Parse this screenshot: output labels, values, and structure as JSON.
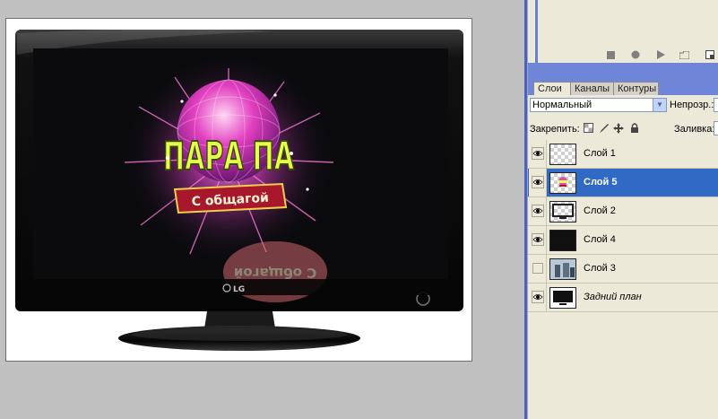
{
  "canvas": {
    "tv_brand": "LG",
    "logo_title": "ПАРА ПА",
    "logo_subtitle": "С общагой",
    "logo_subtitle_reflected": "С общагой"
  },
  "colors": {
    "workspace_bg": "#c0c0c0",
    "panel_bg": "#ece9d8",
    "panel_blue": "#6f86d8",
    "selection": "#316ac5",
    "logo_green": "#e5ff4a",
    "logo_pink": "#e233b8",
    "ribbon_red": "#a8182c"
  },
  "actions_toolbar": {
    "icons": [
      "stop-icon",
      "record-icon",
      "play-icon",
      "new-set-icon",
      "new-action-icon"
    ]
  },
  "layers_panel": {
    "tabs": [
      {
        "label": "Слои",
        "active": true
      },
      {
        "label": "Каналы",
        "active": false
      },
      {
        "label": "Контуры",
        "active": false
      }
    ],
    "blend_mode": "Нормальный",
    "opacity_label": "Непрозр.:",
    "lock_label": "Закрепить:",
    "fill_label": "Заливка:",
    "lock_icons": [
      "lock-transparency-icon",
      "lock-brush-icon",
      "lock-move-icon",
      "lock-all-icon"
    ],
    "layers": [
      {
        "name": "Слой 1",
        "visible": true,
        "selected": false,
        "thumb": "transparent"
      },
      {
        "name": "Слой 5",
        "visible": true,
        "selected": true,
        "thumb": "logo"
      },
      {
        "name": "Слой 2",
        "visible": true,
        "selected": false,
        "thumb": "frame"
      },
      {
        "name": "Слой 4",
        "visible": true,
        "selected": false,
        "thumb": "black"
      },
      {
        "name": "Слой 3",
        "visible": false,
        "selected": false,
        "thumb": "photo"
      },
      {
        "name": "Задний план",
        "visible": true,
        "selected": false,
        "thumb": "tv",
        "italic": true
      }
    ]
  }
}
